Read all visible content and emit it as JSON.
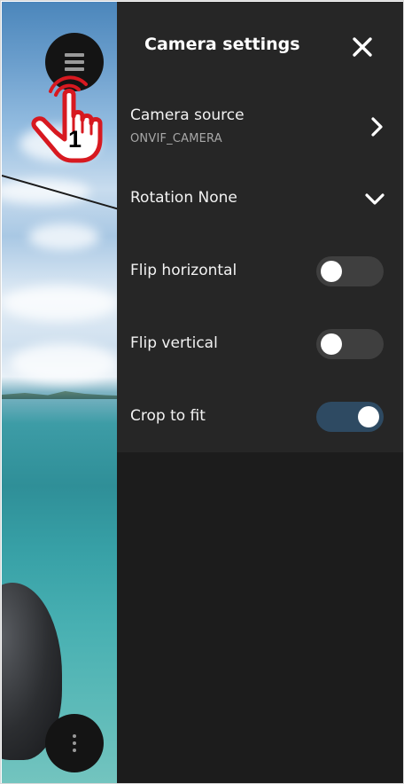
{
  "panel": {
    "title": "Camera settings"
  },
  "settings": {
    "camera_source": {
      "label": "Camera source",
      "value": "ONVIF_CAMERA"
    },
    "rotation": {
      "label": "Rotation None"
    },
    "flip_horizontal": {
      "label": "Flip horizontal",
      "enabled": false
    },
    "flip_vertical": {
      "label": "Flip vertical",
      "enabled": false
    },
    "crop_to_fit": {
      "label": "Crop to fit",
      "enabled": true
    }
  },
  "tap_hint": {
    "step": "1"
  },
  "icons": {
    "menu": "hamburger-icon",
    "more": "more-vertical-icon",
    "close": "close-icon",
    "camera_source": "chevron-right-icon",
    "rotation": "chevron-down-icon",
    "tap": "tap-hand-icon"
  },
  "colors": {
    "panel_bg": "#1c1c1c",
    "panel_card_bg": "#262626",
    "toggle_on": "#2e4a62",
    "toggle_off": "#3f3f3f",
    "hint_red": "#d71920"
  }
}
